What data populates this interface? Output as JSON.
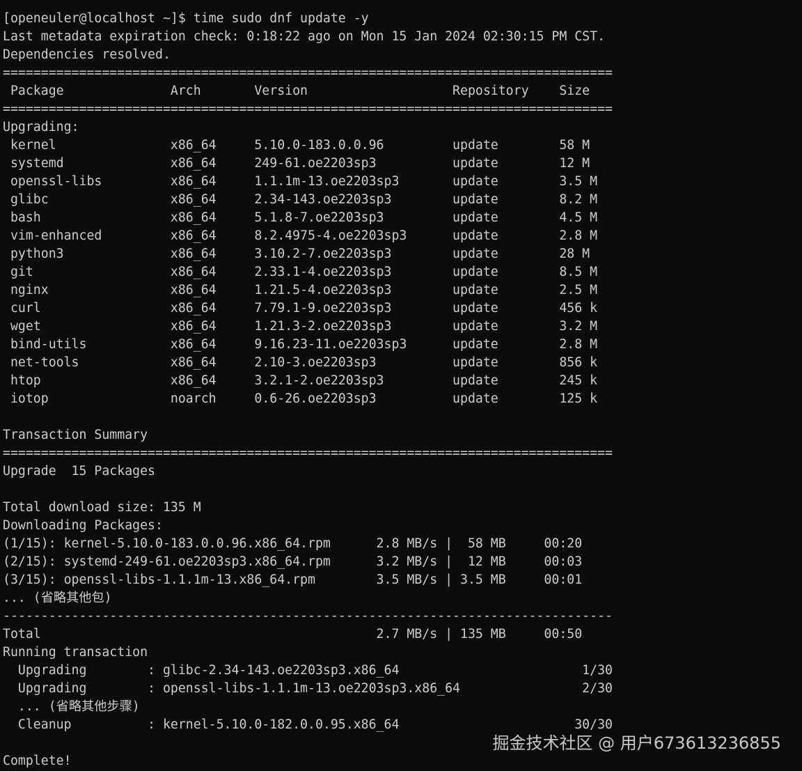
{
  "terminal": {
    "lines": [
      "[openeuler@localhost ~]$ time sudo dnf update -y",
      "Last metadata expiration check: 0:18:22 ago on Mon 15 Jan 2024 02:30:15 PM CST.",
      "Dependencies resolved.",
      "================================================================================",
      " Package              Arch       Version                   Repository    Size",
      "================================================================================",
      "Upgrading:",
      " kernel               x86_64     5.10.0-183.0.0.96         update        58 M",
      " systemd              x86_64     249-61.oe2203sp3          update        12 M",
      " openssl-libs         x86_64     1.1.1m-13.oe2203sp3       update        3.5 M",
      " glibc                x86_64     2.34-143.oe2203sp3        update        8.2 M",
      " bash                 x86_64     5.1.8-7.oe2203sp3         update        4.5 M",
      " vim-enhanced         x86_64     8.2.4975-4.oe2203sp3      update        2.8 M",
      " python3              x86_64     3.10.2-7.oe2203sp3        update        28 M",
      " git                  x86_64     2.33.1-4.oe2203sp3        update        8.5 M",
      " nginx                x86_64     1.21.5-4.oe2203sp3        update        2.5 M",
      " curl                 x86_64     7.79.1-9.oe2203sp3        update        456 k",
      " wget                 x86_64     1.21.3-2.oe2203sp3        update        3.2 M",
      " bind-utils           x86_64     9.16.23-11.oe2203sp3      update        2.8 M",
      " net-tools            x86_64     2.10-3.oe2203sp3          update        856 k",
      " htop                 x86_64     3.2.1-2.oe2203sp3         update        245 k",
      " iotop                noarch     0.6-26.oe2203sp3          update        125 k",
      "",
      "Transaction Summary",
      "================================================================================",
      "Upgrade  15 Packages",
      "",
      "Total download size: 135 M",
      "Downloading Packages:",
      "(1/15): kernel-5.10.0-183.0.0.96.x86_64.rpm      2.8 MB/s |  58 MB     00:20",
      "(2/15): systemd-249-61.oe2203sp3.x86_64.rpm      3.2 MB/s |  12 MB     00:03",
      "(3/15): openssl-libs-1.1.1m-13.x86_64.rpm        3.5 MB/s | 3.5 MB     00:01",
      "... (省略其他包)",
      "--------------------------------------------------------------------------------",
      "Total                                            2.7 MB/s | 135 MB     00:50",
      "Running transaction",
      "  Upgrading        : glibc-2.34-143.oe2203sp3.x86_64                        1/30",
      "  Upgrading        : openssl-libs-1.1.1m-13.oe2203sp3.x86_64                2/30",
      "  ... (省略其他步骤)",
      "  Cleanup          : kernel-5.10.0-182.0.0.95.x86_64                       30/30",
      "",
      "Complete!"
    ]
  },
  "watermark": "掘金技术社区 @ 用户673613236855",
  "colors": {
    "background": "#0c0c0c",
    "text": "#cccccc"
  }
}
